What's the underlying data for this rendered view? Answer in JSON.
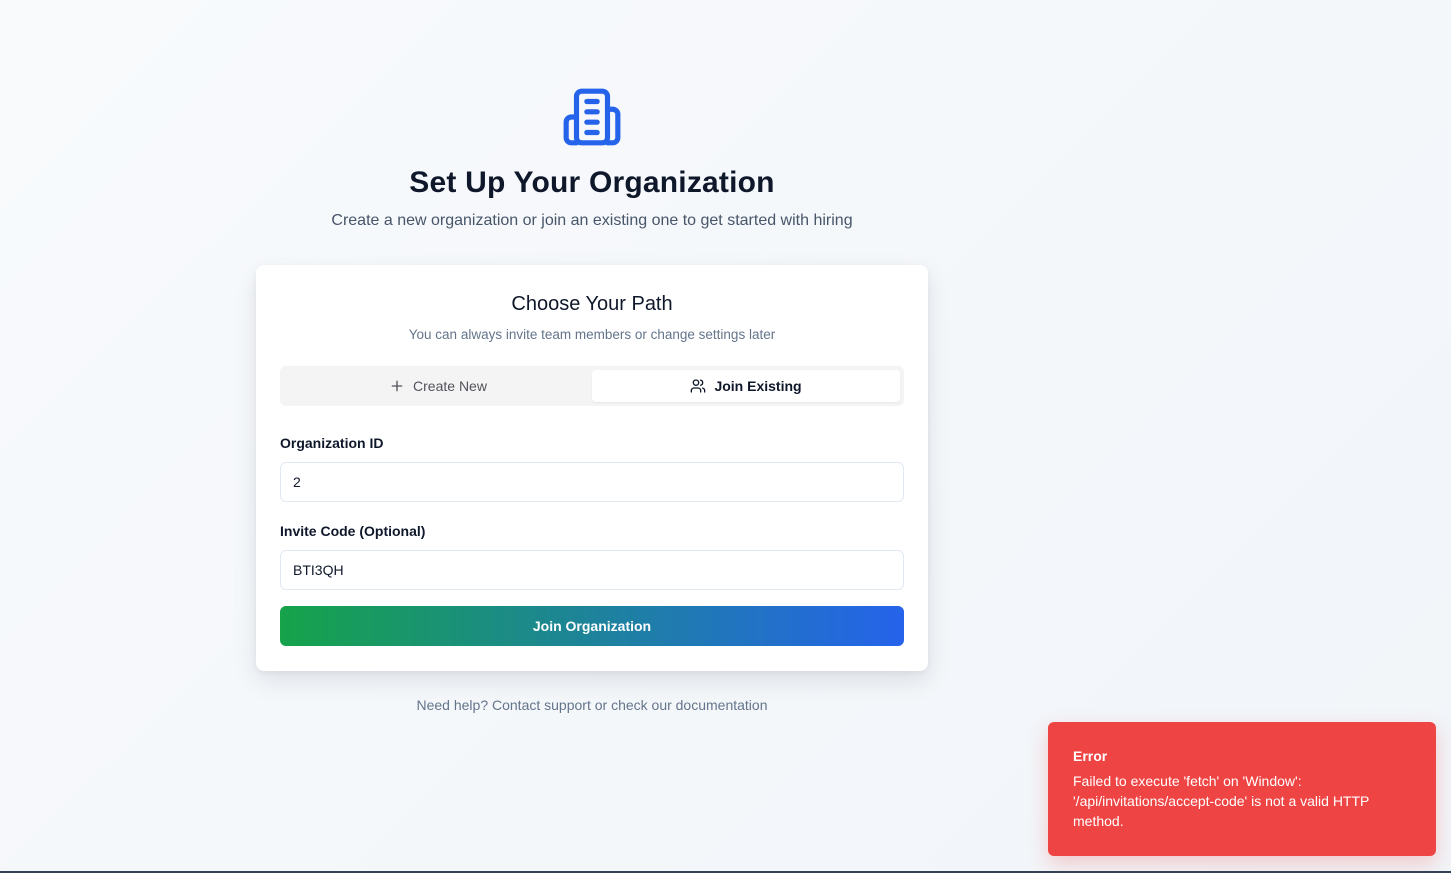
{
  "header": {
    "icon": "building-icon",
    "title": "Set Up Your Organization",
    "subtitle": "Create a new organization or join an existing one to get started with hiring"
  },
  "card": {
    "title": "Choose Your Path",
    "subtitle": "You can always invite team members or change settings later",
    "tabs": [
      {
        "label": "Create New",
        "icon": "plus-icon",
        "active": false
      },
      {
        "label": "Join Existing",
        "icon": "users-icon",
        "active": true
      }
    ],
    "form": {
      "org_id_label": "Organization ID",
      "org_id_value": "2",
      "invite_code_label": "Invite Code (Optional)",
      "invite_code_value": "BTI3QH",
      "submit_label": "Join Organization"
    }
  },
  "footer": {
    "help_text": "Need help? Contact support or check our documentation"
  },
  "toast": {
    "title": "Error",
    "message": "Failed to execute 'fetch' on 'Window': '/api/invitations/accept-code' is not a valid HTTP method."
  },
  "colors": {
    "brand_blue": "#2563eb",
    "brand_green": "#16a34a",
    "error_red": "#ef4444"
  }
}
